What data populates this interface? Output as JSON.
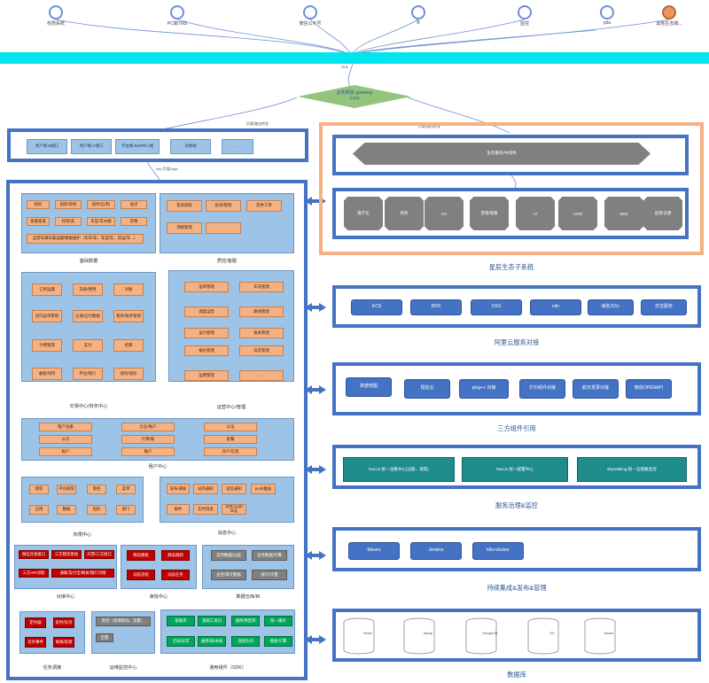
{
  "clients": [
    {
      "label": "权限系统",
      "icon": "client-circle-icon"
    },
    {
      "label": "PC端TMS",
      "icon": "client-circle-icon"
    },
    {
      "label": "微信公众号",
      "icon": "client-circle-icon"
    },
    {
      "label": "B",
      "icon": "client-circle-icon"
    },
    {
      "label": "监控",
      "icon": "client-circle-icon"
    },
    {
      "label": "pda",
      "icon": "client-circle-icon"
    },
    {
      "label": "其他生态端...",
      "icon": "client-circle-icon-orange"
    }
  ],
  "slb_label": "SLB",
  "gateway": {
    "title": "业务网关 gateway",
    "sub": "(nacl)"
  },
  "edge_labels": {
    "gateway_left": "负载/路由转发",
    "gateway_right": "负载/路由转发",
    "top_to_main": "http 负载/logic"
  },
  "top_row": [
    "用户端-B端口",
    "用户端-C端口",
    "平台端-B2B中心端",
    "对接端",
    "…"
  ],
  "left_sections": {
    "base": {
      "caption": "基础数据",
      "items": [
        "组织",
        "组织/架构",
        "组件(信用)",
        "站点",
        "客服渠道",
        "权限/支",
        "车型/车/B端",
        "货物",
        "运营车辆车载运输/数据维护（车车/车、车型/车、货运/车...）"
      ]
    },
    "quality": {
      "caption": "质控/客服",
      "items": [
        "客诉退款",
        "投诉/管理",
        "软件工单",
        "理赔管理",
        ""
      ]
    },
    "trade": {
      "caption": "交易中心/财务中心",
      "items": [
        "订单运输",
        "货款/费用",
        "对账",
        "逆向运单管理",
        "应收/应付数据",
        "税率/账单管理",
        "计费管理",
        "支付",
        "结算",
        "收款/项目",
        "平台/银行",
        "保险/保险"
      ]
    },
    "ops": {
      "caption": "运营中心/管理",
      "items": [
        "运单管理",
        "车货管理",
        "调度运营",
        "路线管理",
        "运力管理",
        "报关管理",
        "报价管理",
        "异常管理",
        "运费管理",
        "…"
      ]
    },
    "tenant": {
      "caption": "租户中心",
      "items": [
        "租户注册",
        "企业/账户",
        "认证",
        "公司",
        "计费/账",
        "套餐",
        "租户",
        "账户",
        "开户/信息"
      ]
    },
    "perm": {
      "caption": "权限中心",
      "items": [
        "授权",
        "平台权限",
        "角色",
        "菜单",
        "应用",
        "数据",
        "组织",
        "部门"
      ]
    },
    "msg": {
      "caption": "消息中心",
      "items": [
        "发布/通知",
        "站内通知",
        "短信通知",
        "push推送",
        "邮件",
        "实时消息",
        "消息/记录/日志"
      ]
    },
    "integ": {
      "caption": "对接中心",
      "items": [
        "微信开放接口",
        "三方物流系统",
        "开票/三方接口",
        "三方API对接",
        "通联/支付宝/网关/银行对接"
      ]
    },
    "audit": {
      "caption": "审批中心",
      "items": [
        "静态模板",
        "静态规则",
        "动态流程",
        "动态任务"
      ]
    },
    "dw": {
      "caption": "数据仓库/BI",
      "items": [
        "实时数据/过滤",
        "业务数据/计算",
        "业务/审计数据",
        "统计/计量"
      ]
    },
    "sched": {
      "caption": "任务调度",
      "items": [
        "定时器",
        "延时/队列",
        "对外事件",
        "离线/处理"
      ]
    },
    "monitor": {
      "caption": "运维监控中心",
      "items": [
        "监控（资源指标、流量）",
        "告警"
      ]
    },
    "common": {
      "caption": "通用组件（SDK）",
      "items": [
        "基础库",
        "基础工具包",
        "通用/用型库",
        "统一缓存",
        "全局/异常",
        "通用/锁/本地",
        "消息队列",
        "搜索/引擎"
      ]
    }
  },
  "right_sections": {
    "ecosystem": {
      "caption": "星辰生态子系统",
      "bus": "生态服务/中间件",
      "items": [
        "数字化",
        "财务",
        "OA",
        "营销/客服",
        "AT",
        "CRM",
        "SMS",
        "运营/支撑"
      ]
    },
    "aliyun": {
      "caption": "阿里云服务对接",
      "items": [
        "ECS",
        "RDS",
        "OSS",
        "cdn",
        "域名/SSL",
        "日志服务"
      ]
    },
    "third": {
      "caption": "三方组件引用",
      "items": [
        "高德地图",
        "短信云",
        "ping++ 对接",
        "打印组件对接",
        "航天发票对接",
        "微信OPENAPI"
      ]
    },
    "govern": {
      "caption": "服务治理&监控",
      "items": [
        "Nacos 统一注册中心(注册、发现)",
        "Nacos 统一配置中心",
        "skywalking 统一全链路监控"
      ]
    },
    "cicd": {
      "caption": "持续集成&发布&管理",
      "items": [
        "Maven",
        "Jenkins",
        "k8s+docker"
      ]
    },
    "db": {
      "caption": "数据库",
      "items": [
        "Redis",
        "Mysql",
        "MongoDB",
        "ES",
        "Hbase"
      ]
    }
  }
}
